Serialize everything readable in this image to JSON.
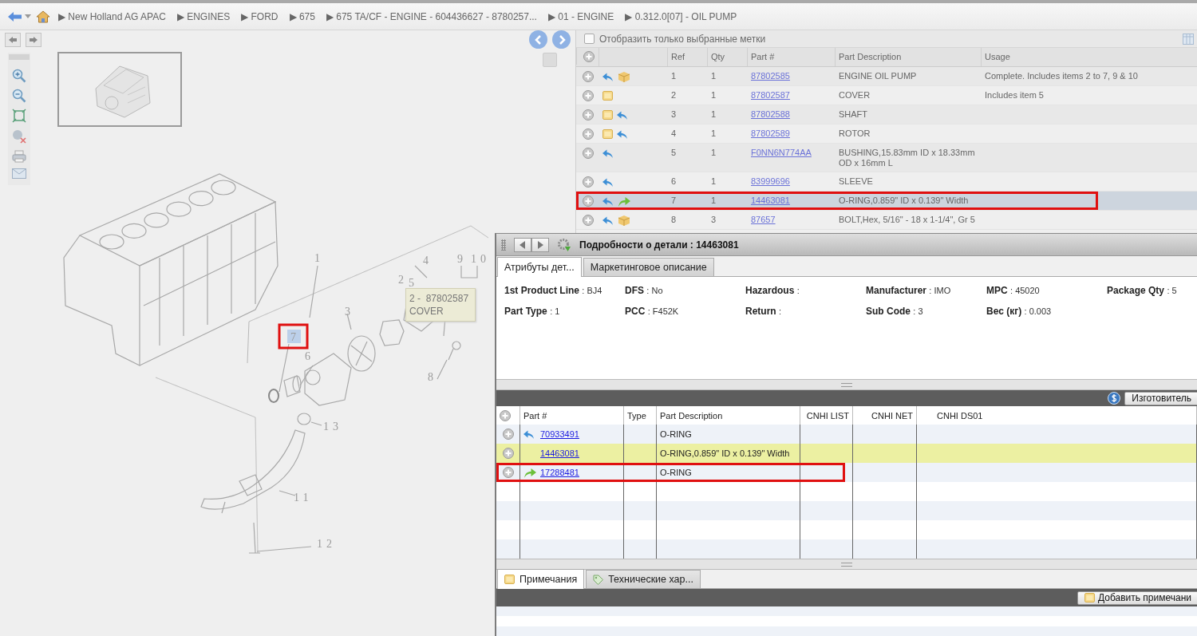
{
  "breadcrumb": [
    "▶ New Holland AG APAC",
    "▶ ENGINES",
    "▶ FORD",
    "▶ 675",
    "▶ 675 TA/CF - ENGINE - 604436627 - 8780257...",
    "▶ 01 - ENGINE",
    "▶ 0.312.0[07] - OIL PUMP"
  ],
  "diagram": {
    "callouts": [
      {
        "label": "1",
        "marked": false
      },
      {
        "label": "2",
        "marked": false
      },
      {
        "label": "5",
        "marked": false
      },
      {
        "label": "4",
        "marked": false
      },
      {
        "label": "9",
        "marked": false
      },
      {
        "label": "10",
        "marked": false
      },
      {
        "label": "3",
        "marked": false
      },
      {
        "label": "6",
        "marked": false
      },
      {
        "label": "7",
        "marked": true
      },
      {
        "label": "8",
        "marked": false
      },
      {
        "label": "13",
        "marked": false
      },
      {
        "label": "11",
        "marked": false
      },
      {
        "label": "12",
        "marked": false
      }
    ],
    "tooltip": [
      "2 -  87802587",
      "COVER"
    ]
  },
  "filter": {
    "label": "Отобразить только выбранные метки",
    "checked": false
  },
  "parts_table": {
    "columns": [
      "Ref",
      "Qty",
      "Part #",
      "Part Description",
      "Usage"
    ],
    "rows": [
      {
        "has_note": false,
        "superseded": true,
        "kit": true,
        "has_replacement": false,
        "ref": "1",
        "qty": "1",
        "part": "87802585",
        "description": "ENGINE OIL PUMP",
        "usage": "Complete. Includes items 2 to 7, 9 & 10",
        "selected": false,
        "marked": false
      },
      {
        "has_note": true,
        "superseded": false,
        "kit": false,
        "has_replacement": false,
        "ref": "2",
        "qty": "1",
        "part": "87802587",
        "description": "COVER",
        "usage": "Includes item 5",
        "selected": false,
        "marked": false
      },
      {
        "has_note": true,
        "superseded": true,
        "kit": false,
        "has_replacement": false,
        "ref": "3",
        "qty": "1",
        "part": "87802588",
        "description": "SHAFT",
        "selected": false,
        "marked": false
      },
      {
        "has_note": true,
        "superseded": true,
        "kit": false,
        "has_replacement": false,
        "ref": "4",
        "qty": "1",
        "part": "87802589",
        "description": "ROTOR",
        "selected": false,
        "marked": false
      },
      {
        "has_note": false,
        "superseded": true,
        "kit": false,
        "has_replacement": false,
        "ref": "5",
        "qty": "1",
        "part": "F0NN6N774AA",
        "description": "BUSHING,15.83mm ID x 18.33mm OD x 16mm L",
        "selected": false,
        "marked": false
      },
      {
        "has_note": false,
        "superseded": true,
        "kit": false,
        "has_replacement": false,
        "ref": "6",
        "qty": "1",
        "part": "83999696",
        "description": "SLEEVE",
        "selected": false,
        "marked": false
      },
      {
        "has_note": false,
        "superseded": true,
        "kit": false,
        "has_replacement": true,
        "ref": "7",
        "qty": "1",
        "part": "14463081",
        "description": "O-RING,0.859\" ID x 0.139\" Width",
        "selected": true,
        "marked": true
      },
      {
        "has_note": false,
        "superseded": true,
        "kit": true,
        "has_replacement": false,
        "ref": "8",
        "qty": "3",
        "part": "87657",
        "description": "BOLT,Hex, 5/16\" - 18 x 1-1/4\", Gr 5",
        "selected": false,
        "marked": false
      }
    ]
  },
  "detail": {
    "title": "Подробности о детали : 14463081",
    "tabs": [
      {
        "label": "Атрибуты дет...",
        "selected": true
      },
      {
        "label": "Маркетинговое описание",
        "selected": false
      }
    ],
    "attributes": [
      {
        "label": "1st Product Line",
        "value": ": BJ4"
      },
      {
        "label": "DFS",
        "value": ": No"
      },
      {
        "label": "Hazardous",
        "value": ":"
      },
      {
        "label": "Manufacturer",
        "value": ": IMO"
      },
      {
        "label": "MPC",
        "value": ": 45020"
      },
      {
        "label": "Package Qty",
        "value": ": 5"
      },
      {
        "label": "Part Type",
        "value": ": 1"
      },
      {
        "label": "PCC",
        "value": ": F452K"
      },
      {
        "label": "Return",
        "value": ":"
      },
      {
        "label": "Sub Code",
        "value": ": 3"
      },
      {
        "label": "Вес (кг)",
        "value": ": 0.003"
      }
    ],
    "manufacturer_button": "Изготовитель",
    "columns": [
      "Part #",
      "Type",
      "Part Description",
      "CNHI LIST",
      "CNHI NET",
      "CNHI DS01"
    ],
    "rows": [
      {
        "superseded": true,
        "has_replacement": false,
        "part": "70933491",
        "description": "O-RING",
        "current": false,
        "marked": false
      },
      {
        "superseded": false,
        "has_replacement": false,
        "part": "14463081",
        "description": "O-RING,0.859\" ID x 0.139\" Width",
        "current": true,
        "marked": false
      },
      {
        "superseded": false,
        "has_replacement": true,
        "part": "17288481",
        "description": "O-RING",
        "current": false,
        "marked": true
      }
    ],
    "bottom_tabs": [
      {
        "label": "Примечания",
        "selected": true
      },
      {
        "label": "Технические хар...",
        "selected": false
      }
    ],
    "add_note_button": "Добавить примечани"
  }
}
